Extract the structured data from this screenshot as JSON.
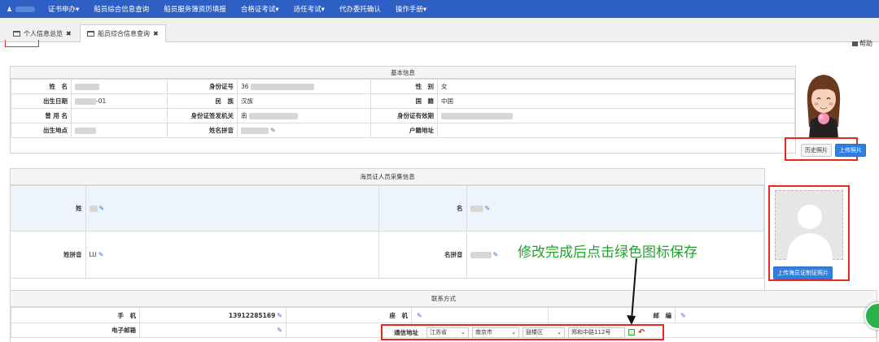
{
  "navbar": {
    "items": [
      "证书申办▾",
      "船员综合信息查询",
      "船员服务簿资历填报",
      "合格证考试▾",
      "适任考试▾",
      "代办委托确认",
      "操作手册▾"
    ]
  },
  "tabs": [
    {
      "label": "个人信息总览"
    },
    {
      "label": "船员综合信息查询"
    }
  ],
  "help_label": "帮助",
  "basic": {
    "title": "基本信息",
    "name_label": "姓　名",
    "idno_label": "身份证号",
    "idno_prefix": "36",
    "gender_label": "性　别",
    "gender_value": "女",
    "dob_label": "出生日期",
    "dob_suffix": "-01",
    "ethnic_label": "民　族",
    "ethnic_value": "汉族",
    "nationality_label": "国　籍",
    "nationality_value": "中国",
    "former_label": "曾 用 名",
    "issuer_label": "身份证签发机关",
    "issuer_prefix": "南",
    "validity_label": "身份证有效期",
    "birthplace_label": "出生地点",
    "pinyin_label": "姓名拼音",
    "domicile_label": "户籍地址",
    "history_photo_btn": "历史照片",
    "upload_photo_btn": "上传照片"
  },
  "seafarer": {
    "title": "海员证人员采集信息",
    "surname_label": "姓",
    "given_label": "名",
    "surname_pinyin_label": "姓拼音",
    "surname_pinyin_value": "LU",
    "given_pinyin_label": "名拼音",
    "upload_btn": "上传海员证制证照片"
  },
  "annotation": "修改完成后点击绿色图标保存",
  "contact": {
    "title": "联系方式",
    "mobile_label": "手　机",
    "mobile_value": "13912285169",
    "landline_label": "座　机",
    "postcode_label": "邮　编",
    "email_label": "电子邮箱",
    "address_label": "通信地址",
    "province": "江苏省",
    "city": "南京市",
    "district": "鼓楼区",
    "street": "郑和中路112号"
  },
  "colors": {
    "nav": "#2d5fc4",
    "highlight": "#e8271f",
    "annotation": "#1fa42a",
    "primary_btn": "#2f7fe0"
  }
}
